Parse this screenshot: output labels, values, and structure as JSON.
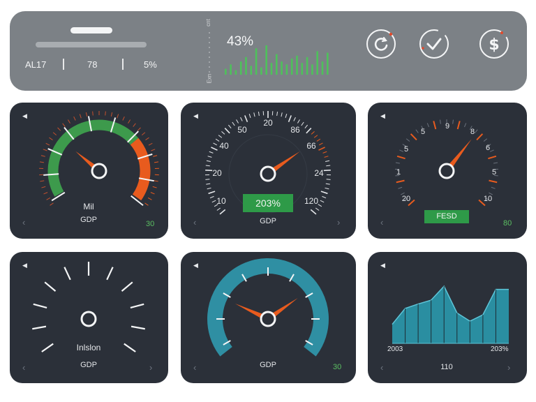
{
  "header": {
    "stats": [
      "AL17",
      "78",
      "5%"
    ],
    "percent": "43%",
    "axis_top": "cnt",
    "axis_bottom": "Exn",
    "sparkline": [
      4,
      7,
      3,
      9,
      12,
      6,
      18,
      5,
      20,
      8,
      14,
      9,
      7,
      11,
      13,
      8,
      12,
      7,
      16,
      9,
      15
    ]
  },
  "cards": {
    "c1": {
      "label1": "Mil",
      "label2": "GDP",
      "value": "30",
      "needle_pct": 0.33
    },
    "c2": {
      "ticks": [
        "10",
        "20",
        "40",
        "50",
        "20",
        "86",
        "66",
        "24",
        "120"
      ],
      "badge": "203%",
      "label": "GDP",
      "needle_pct": 0.7
    },
    "c3": {
      "ticks": [
        "20",
        "1",
        "5",
        "5",
        "9",
        "8",
        "6",
        "5",
        "10"
      ],
      "badge": "FESD",
      "value": "80",
      "needle_pct": 0.72
    },
    "c4": {
      "label1": "Inlslon",
      "label2": "GDP"
    },
    "c5": {
      "label": "GDP",
      "value": "30",
      "needle_pct": 0.75
    },
    "c6": {
      "xstart": "2003",
      "xend": "203%",
      "label": "110",
      "area": [
        0.3,
        0.55,
        0.62,
        0.68,
        0.9,
        0.48,
        0.35,
        0.45,
        0.85,
        0.85
      ]
    }
  },
  "colors": {
    "green": "#3d9a4c",
    "orange": "#e85b1e",
    "teal": "#2f8fa3",
    "card": "#2b3039"
  }
}
